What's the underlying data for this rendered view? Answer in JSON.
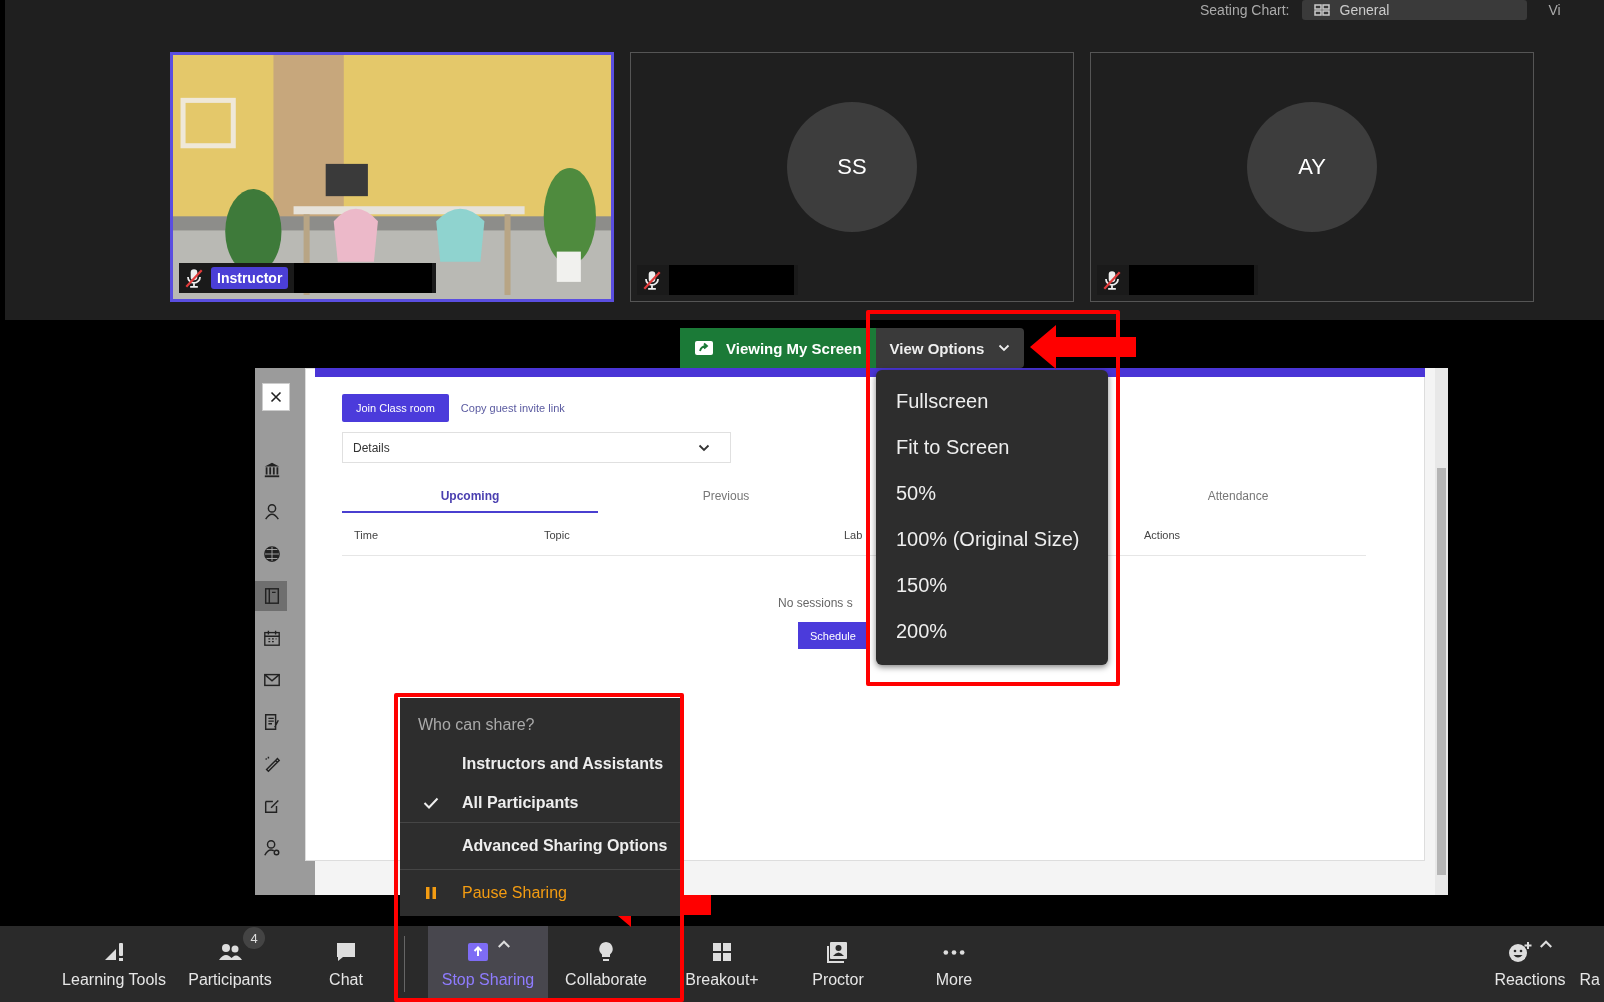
{
  "seating_chart": {
    "label": "Seating Chart:",
    "value": "General",
    "cut_text": "Vi"
  },
  "tiles": [
    {
      "kind": "video",
      "muted": true,
      "role": "Instructor",
      "highlighted": true
    },
    {
      "kind": "avatar",
      "initials": "SS",
      "muted": true,
      "highlighted": false
    },
    {
      "kind": "avatar",
      "initials": "AY",
      "muted": true,
      "highlighted": false
    }
  ],
  "share_banner": {
    "status": "Viewing My Screen",
    "view_options": "View Options"
  },
  "view_options_menu": {
    "items": [
      "Fullscreen",
      "Fit to Screen",
      "50%",
      "100% (Original Size)",
      "150%",
      "200%"
    ]
  },
  "shared_screen": {
    "join_button": "Join Class room",
    "invite_link": "Copy guest invite link",
    "details_select": "Details",
    "tabs": [
      {
        "label": "Upcoming",
        "selected": true
      },
      {
        "label": "Previous",
        "selected": false
      },
      {
        "label": "Attendance",
        "selected": false
      }
    ],
    "columns": [
      "Time",
      "Topic",
      "Lab",
      "Actions"
    ],
    "empty_message": "No sessions s",
    "schedule_button": "Schedule",
    "sidebar_items": [
      {
        "selected": false
      },
      {
        "selected": false
      },
      {
        "selected": false
      },
      {
        "selected": true
      },
      {
        "selected": false
      },
      {
        "selected": false
      },
      {
        "selected": false
      },
      {
        "selected": false
      },
      {
        "selected": false
      },
      {
        "selected": false
      }
    ]
  },
  "share_menu": {
    "heading": "Who can share?",
    "options": [
      {
        "label": "Instructors and Assistants",
        "checked": false
      },
      {
        "label": "All Participants",
        "checked": true
      }
    ],
    "advanced": "Advanced Sharing Options",
    "pause": "Pause Sharing"
  },
  "toolbar": {
    "left": [
      {
        "label": "Learning Tools",
        "active": false,
        "caret": false
      },
      {
        "label": "Participants",
        "badge": "4",
        "active": false,
        "caret": false
      },
      {
        "label": "Chat",
        "active": false,
        "caret": false
      },
      {
        "label": "Stop Sharing",
        "active": true,
        "caret": true
      },
      {
        "label": "Collaborate",
        "active": false,
        "caret": false
      },
      {
        "label": "Breakout+",
        "active": false,
        "caret": false
      },
      {
        "label": "Proctor",
        "active": false,
        "caret": false
      },
      {
        "label": "More",
        "active": false,
        "caret": false
      }
    ],
    "right": [
      {
        "label": "Reactions",
        "caret": true
      },
      {
        "label": "Ra",
        "caret": false
      }
    ]
  }
}
